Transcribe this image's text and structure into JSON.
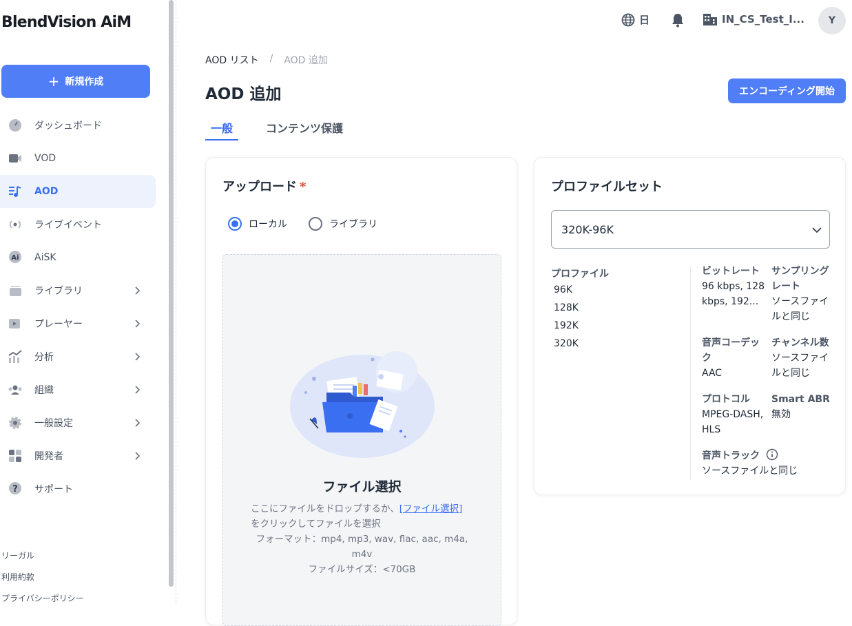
{
  "app": {
    "logo": "BlendVision AiM"
  },
  "sidebar": {
    "new_button": "新規作成",
    "items": [
      {
        "label": "ダッシュボード",
        "icon": "gauge-icon"
      },
      {
        "label": "VOD",
        "icon": "video-camera-icon"
      },
      {
        "label": "AOD",
        "icon": "music-note-icon"
      },
      {
        "label": "ライブイベント",
        "icon": "broadcast-icon"
      },
      {
        "label": "AiSK",
        "icon": "ai-chat-icon"
      },
      {
        "label": "ライブラリ",
        "icon": "library-icon"
      },
      {
        "label": "プレーヤー",
        "icon": "player-icon"
      },
      {
        "label": "分析",
        "icon": "analytics-icon"
      },
      {
        "label": "組織",
        "icon": "organization-icon"
      },
      {
        "label": "一般設定",
        "icon": "gear-icon"
      },
      {
        "label": "開発者",
        "icon": "developer-icon"
      },
      {
        "label": "サポート",
        "icon": "help-icon"
      }
    ],
    "active_item": "AOD",
    "legal": {
      "heading": "リーガル",
      "terms": "利用約款",
      "privacy": "プライバシーポリシー"
    }
  },
  "topbar": {
    "language": "日",
    "organization": "IN_CS_Test_I...",
    "avatar_initial": "Y"
  },
  "breadcrumb": {
    "parent": "AOD リスト",
    "separator": "/",
    "current": "AOD 追加"
  },
  "page": {
    "title": "AOD 追加",
    "primary_button": "エンコーディング開始"
  },
  "tabs": [
    {
      "label": "一般",
      "active": true
    },
    {
      "label": "コンテンツ保護",
      "active": false
    }
  ],
  "upload": {
    "title": "アップロード",
    "required_mark": "*",
    "options": [
      {
        "label": "ローカル",
        "selected": true
      },
      {
        "label": "ライブラリ",
        "selected": false
      }
    ],
    "dropzone_title": "ファイル選択",
    "dropzone_text_before": "ここにファイルをドロップするか、",
    "dropzone_link": "[ファイル選択]",
    "dropzone_text_after": "をクリックしてファイルを選択",
    "format_line1": "フォーマット：mp4, mp3, wav, flac, aac, m4a,",
    "format_line2": "m4v",
    "size": "ファイルサイズ：<70GB"
  },
  "profile_set": {
    "title": "プロファイルセット",
    "selected": "320K-96K",
    "profiles_label": "プロファイル",
    "profiles": [
      "96K",
      "128K",
      "192K",
      "320K"
    ],
    "bitrate_label": "ビットレート",
    "bitrate_value_1": "96 kbps, 128",
    "bitrate_value_2": "kbps, 192...",
    "sampling_label_1": "サンプリング",
    "sampling_label_2": "レート",
    "sampling_value_1": "ソースファイ",
    "sampling_value_2": "ルと同じ",
    "codec_label_1": "音声コーデッ",
    "codec_label_2": "ク",
    "codec_value": "AAC",
    "channels_label": "チャンネル数",
    "channels_value_1": "ソースファイ",
    "channels_value_2": "ルと同じ",
    "protocol_label": "プロトコル",
    "protocol_value_1": "MPEG-DASH,",
    "protocol_value_2": "HLS",
    "smart_abr_label": "Smart ABR",
    "smart_abr_value": "無効",
    "audio_track_label": "音声トラック",
    "audio_track_value": "ソースファイルと同じ"
  },
  "colors": {
    "accent": "#4f7ef7",
    "active_bg": "#eef2fd",
    "required": "#e5533d"
  }
}
